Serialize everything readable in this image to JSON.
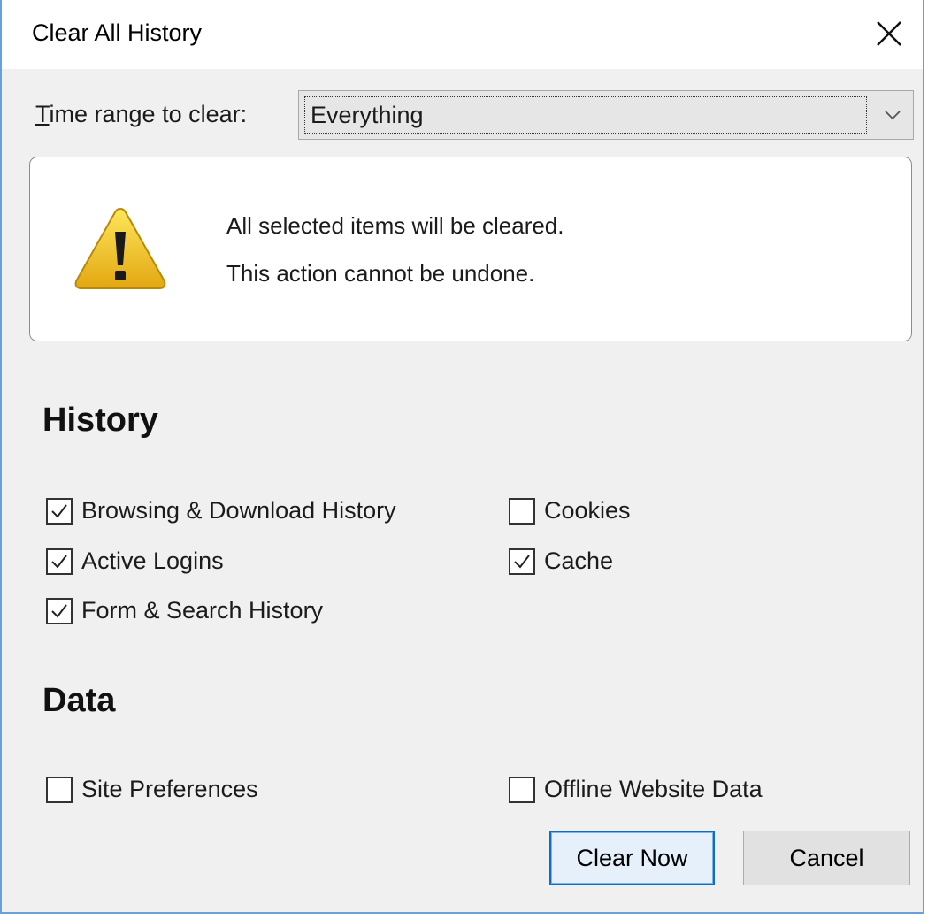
{
  "window": {
    "title": "Clear All History"
  },
  "time_range": {
    "label_underlined": "T",
    "label_rest": "ime range to clear:",
    "value": "Everything"
  },
  "warning": {
    "line1": "All selected items will be cleared.",
    "line2": "This action cannot be undone."
  },
  "history": {
    "heading": "History",
    "items": [
      {
        "label": "Browsing & Download History",
        "checked": true
      },
      {
        "label": "Cookies",
        "checked": false
      },
      {
        "label": "Active Logins",
        "checked": true
      },
      {
        "label": "Cache",
        "checked": true
      },
      {
        "label": "Form & Search History",
        "checked": true
      }
    ]
  },
  "data": {
    "heading": "Data",
    "items": [
      {
        "label": "Site Preferences",
        "checked": false
      },
      {
        "label": "Offline Website Data",
        "checked": false
      }
    ]
  },
  "buttons": {
    "clear_now": "Clear Now",
    "cancel": "Cancel"
  },
  "icons": {
    "close": "close-icon",
    "dropdown": "chevron-down-icon",
    "warning": "warning-icon",
    "check": "checkmark-icon"
  },
  "colors": {
    "window_border": "#6aa0d8",
    "default_button_border": "#0f6ec4",
    "warning_yellow": "#f2c21b"
  }
}
